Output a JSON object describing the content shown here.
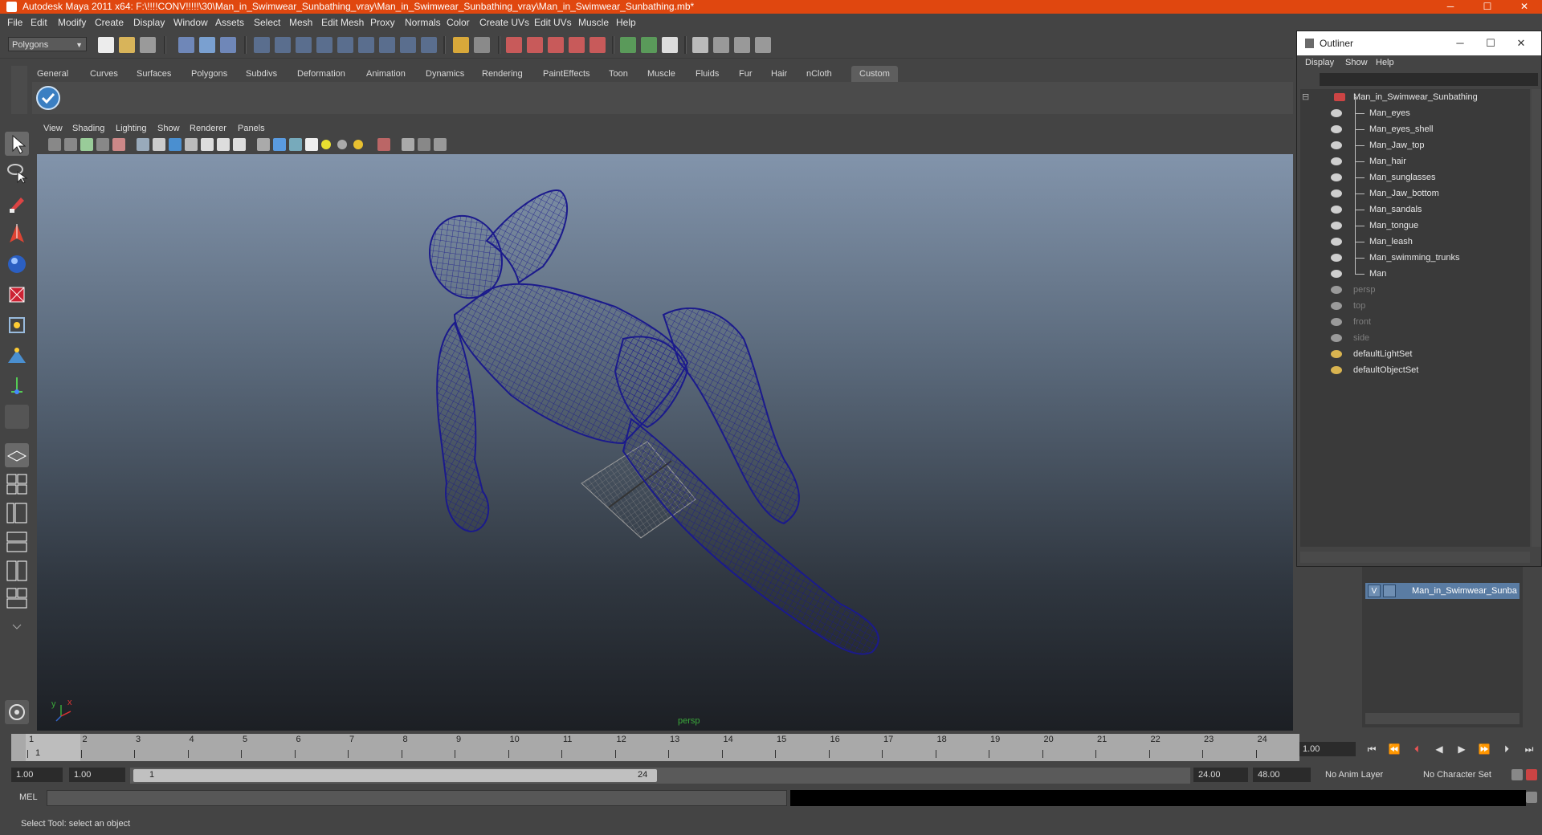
{
  "window": {
    "title": "Autodesk Maya 2011 x64: F:\\!!!!CONV!!!!!\\30\\Man_in_Swimwear_Sunbathing_vray\\Man_in_Swimwear_Sunbathing_vray\\Man_in_Swimwear_Sunbathing.mb*",
    "minimize": "─",
    "maximize": "☐",
    "close": "✕"
  },
  "menubar": [
    "File",
    "Edit",
    "Modify",
    "Create",
    "Display",
    "Window",
    "Assets",
    "Select",
    "Mesh",
    "Edit Mesh",
    "Proxy",
    "Normals",
    "Color",
    "Create UVs",
    "Edit UVs",
    "Muscle",
    "Help"
  ],
  "statusline": {
    "mode": "Polygons"
  },
  "shelf": {
    "tabs": [
      "General",
      "Curves",
      "Surfaces",
      "Polygons",
      "Subdivs",
      "Deformation",
      "Animation",
      "Dynamics",
      "Rendering",
      "PaintEffects",
      "Toon",
      "Muscle",
      "Fluids",
      "Fur",
      "Hair",
      "nCloth",
      "Custom"
    ],
    "active": "Custom"
  },
  "viewport": {
    "menu": [
      "View",
      "Shading",
      "Lighting",
      "Show",
      "Renderer",
      "Panels"
    ],
    "camera": "persp",
    "axis_y": "y",
    "axis_x": "x"
  },
  "timeline": {
    "ticks": [
      "1",
      "2",
      "3",
      "4",
      "5",
      "6",
      "7",
      "8",
      "9",
      "10",
      "11",
      "12",
      "13",
      "14",
      "15",
      "16",
      "17",
      "18",
      "19",
      "20",
      "21",
      "22",
      "23",
      "24"
    ],
    "current_marker": "1",
    "current_frame": "1.00"
  },
  "range": {
    "start": "1.00",
    "playback_start": "1.00",
    "handle_start": "1",
    "handle_end": "24",
    "playback_end": "24.00",
    "end": "48.00",
    "anim_layer": "No Anim Layer",
    "character_set": "No Character Set"
  },
  "command": {
    "label": "MEL"
  },
  "help_line": "Select Tool: select an object",
  "outliner": {
    "title": "Outliner",
    "menu": [
      "Display",
      "Show",
      "Help"
    ],
    "root": "Man_in_Swimwear_Sunbathing",
    "children": [
      "Man_eyes",
      "Man_eyes_shell",
      "Man_Jaw_top",
      "Man_hair",
      "Man_sunglasses",
      "Man_Jaw_bottom",
      "Man_sandals",
      "Man_tongue",
      "Man_leash",
      "Man_swimming_trunks",
      "Man"
    ],
    "cameras": [
      "persp",
      "top",
      "front",
      "side"
    ],
    "sets": [
      "defaultLightSet",
      "defaultObjectSet"
    ]
  },
  "layers": {
    "visible_flag": "V",
    "layer_name": "Man_in_Swimwear_Sunba"
  },
  "colors": {
    "titlebar": "#e0470f",
    "wireframe": "#1b1a8c",
    "camera_label": "#3aa83a",
    "layer_highlight": "#5a7ca3"
  }
}
